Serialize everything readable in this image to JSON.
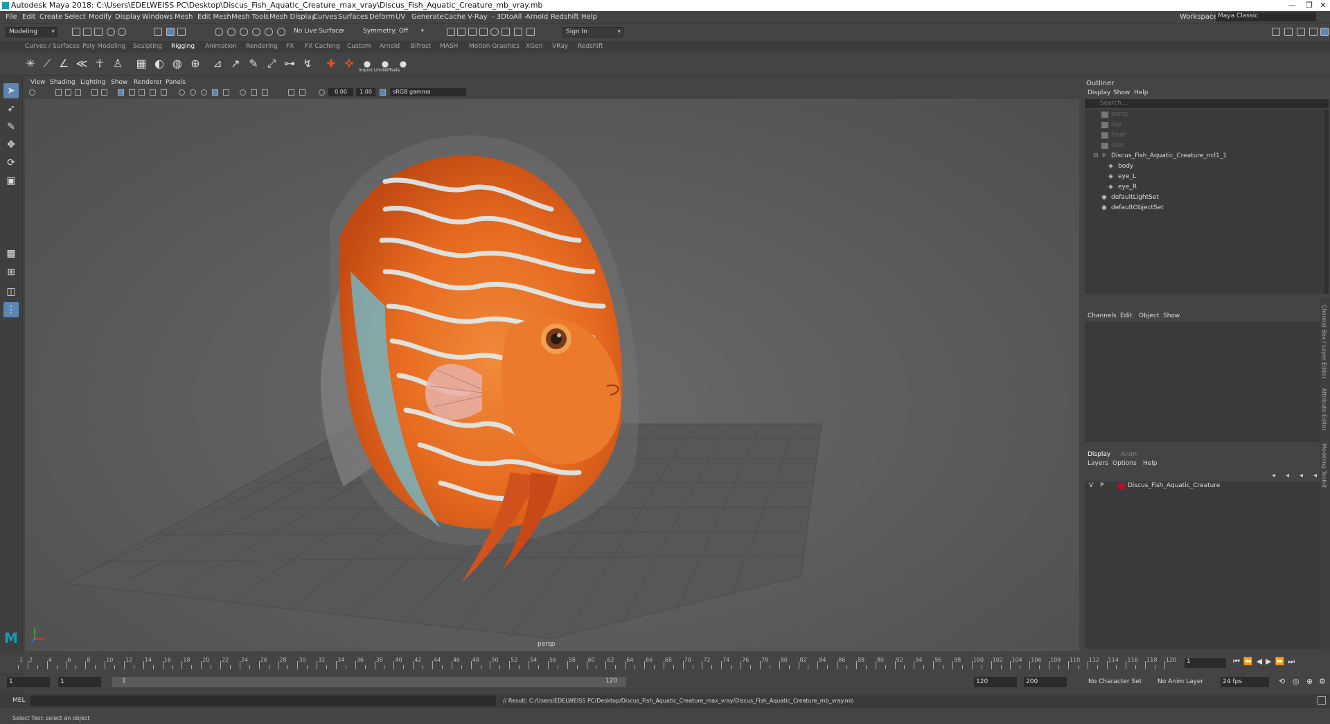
{
  "window": {
    "title": "Autodesk Maya 2018: C:\\Users\\EDELWEISS PC\\Desktop\\Discus_Fish_Aquatic_Creature_max_vray\\Discus_Fish_Aquatic_Creature_mb_vray.mb",
    "minimize": "—",
    "maximize": "❐",
    "close": "✕"
  },
  "menubar": {
    "items": [
      "File",
      "Edit",
      "Create",
      "Select",
      "Modify",
      "Display",
      "Windows",
      "Mesh",
      "Edit Mesh",
      "Mesh Tools",
      "Mesh Display",
      "Curves",
      "Surfaces",
      "Deform",
      "UV",
      "Generate",
      "Cache",
      "V-Ray",
      "- 3DtoAll -",
      "Arnold",
      "Redshift",
      "Help"
    ],
    "workspace_label": "Workspace :",
    "workspace_value": "Maya Classic"
  },
  "statusline": {
    "menuset": "Modeling",
    "live_surface": "No Live Surface",
    "symmetry": "Symmetry: Off",
    "sign_in": "Sign In"
  },
  "shelf": {
    "tabs": [
      "Curves / Surfaces",
      "Poly Modeling",
      "Sculpting",
      "Rigging",
      "Animation",
      "Rendering",
      "FX",
      "FX Caching",
      "Custom",
      "Arnold",
      "Bifrost",
      "MASH",
      "Motion Graphics",
      "XGen",
      "VRay",
      "Redshift"
    ],
    "active_tab": "Rigging",
    "import_label": "Import Limits",
    "offset_label": "Offsets"
  },
  "viewport": {
    "menus": [
      "View",
      "Shading",
      "Lighting",
      "Show",
      "Renderer",
      "Panels"
    ],
    "exposure": "0.00",
    "gamma": "1.00",
    "color_space": "sRGB gamma",
    "camera_label": "persp"
  },
  "outliner": {
    "title": "Outliner",
    "menus": [
      "Display",
      "Show",
      "Help"
    ],
    "search_placeholder": "Search...",
    "items": [
      {
        "label": "persp",
        "dim": true,
        "indent": 0,
        "icon": "camera"
      },
      {
        "label": "top",
        "dim": true,
        "indent": 0,
        "icon": "camera"
      },
      {
        "label": "front",
        "dim": true,
        "indent": 0,
        "icon": "camera"
      },
      {
        "label": "side",
        "dim": true,
        "indent": 0,
        "icon": "camera"
      },
      {
        "label": "Discus_Fish_Aquatic_Creature_ncl1_1",
        "dim": false,
        "indent": 0,
        "icon": "group"
      },
      {
        "label": "body",
        "dim": false,
        "indent": 1,
        "icon": "mesh"
      },
      {
        "label": "eye_L",
        "dim": false,
        "indent": 1,
        "icon": "mesh"
      },
      {
        "label": "eye_R",
        "dim": false,
        "indent": 1,
        "icon": "mesh"
      },
      {
        "label": "defaultLightSet",
        "dim": false,
        "indent": 0,
        "icon": "set"
      },
      {
        "label": "defaultObjectSet",
        "dim": false,
        "indent": 0,
        "icon": "set"
      }
    ]
  },
  "channelbox": {
    "menus": [
      "Channels",
      "Edit",
      "Object",
      "Show"
    ]
  },
  "layers": {
    "tabs": [
      "Display",
      "Anim"
    ],
    "menus": [
      "Layers",
      "Options",
      "Help"
    ],
    "layer": {
      "v": "V",
      "p": "P",
      "name": "Discus_Fish_Aquatic_Creature",
      "color": "#b0102a"
    }
  },
  "sidebar_tabs": [
    "Channel Box / Layer Editor",
    "Attribute Editor",
    "Modeling Toolkit"
  ],
  "timeslider": {
    "ticks": [
      "1",
      "2",
      "4",
      "6",
      "8",
      "10",
      "12",
      "14",
      "16",
      "18",
      "20",
      "22",
      "24",
      "26",
      "28",
      "30",
      "32",
      "34",
      "36",
      "38",
      "40",
      "42",
      "44",
      "46",
      "48",
      "50",
      "52",
      "54",
      "56",
      "58",
      "60",
      "62",
      "64",
      "66",
      "68",
      "70",
      "72",
      "74",
      "76",
      "78",
      "80",
      "82",
      "84",
      "86",
      "88",
      "90",
      "92",
      "94",
      "96",
      "98",
      "100",
      "102",
      "104",
      "106",
      "108",
      "110",
      "112",
      "114",
      "116",
      "118",
      "120"
    ],
    "current_frame": "1"
  },
  "range": {
    "start": "1",
    "playback_start": "1",
    "slider_start": "1",
    "slider_end": "120",
    "playback_end": "120",
    "end": "200",
    "character_set": "No Character Set",
    "anim_layer": "No Anim Layer",
    "fps": "24 fps"
  },
  "command": {
    "lang": "MEL",
    "result": "// Result: C:/Users/EDELWEISS PC/Desktop/Discus_Fish_Aquatic_Creature_max_vray/Discus_Fish_Aquatic_Creature_mb_vray.mb"
  },
  "helpline": "Select Tool: select an object",
  "colors": {
    "accent": "#5d86b3",
    "fish_orange": "#e8742a",
    "fish_blue": "#9fd4e6",
    "layer_red": "#b0102a"
  }
}
